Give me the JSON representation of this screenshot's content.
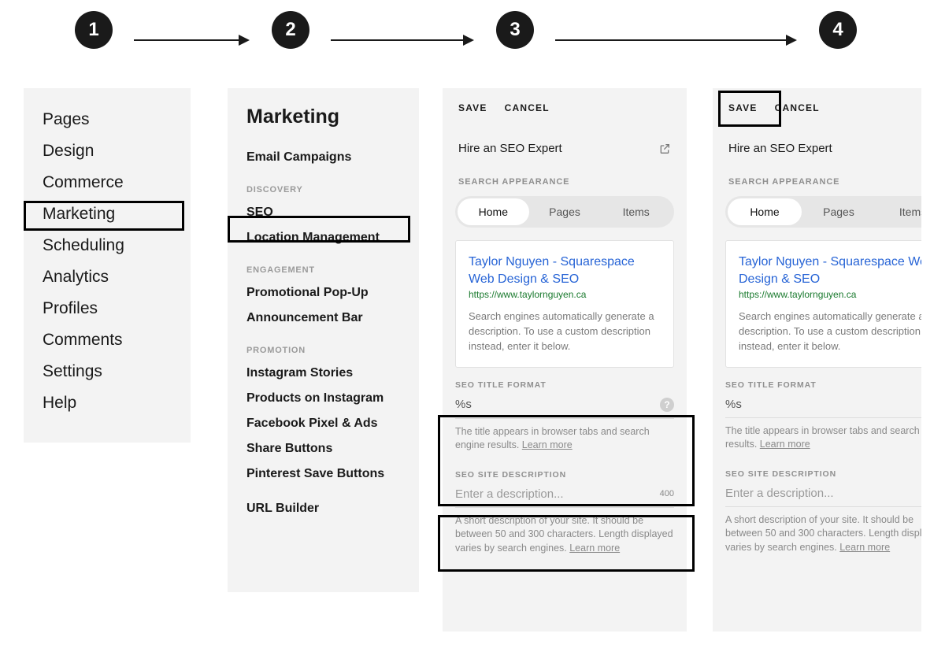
{
  "steps": [
    "1",
    "2",
    "3",
    "4"
  ],
  "panel1": {
    "items": [
      "Pages",
      "Design",
      "Commerce",
      "Marketing",
      "Scheduling",
      "Analytics",
      "Profiles",
      "Comments",
      "Settings",
      "Help"
    ]
  },
  "panel2": {
    "title": "Marketing",
    "groups": [
      {
        "label": null,
        "items": [
          "Email Campaigns"
        ]
      },
      {
        "label": "DISCOVERY",
        "items": [
          "SEO",
          "Location Management"
        ]
      },
      {
        "label": "ENGAGEMENT",
        "items": [
          "Promotional Pop-Up",
          "Announcement Bar"
        ]
      },
      {
        "label": "PROMOTION",
        "items": [
          "Instagram Stories",
          "Products on Instagram",
          "Facebook Pixel & Ads",
          "Share Buttons",
          "Pinterest Save Buttons"
        ]
      },
      {
        "label": null,
        "items": [
          "URL Builder"
        ]
      }
    ]
  },
  "seo": {
    "save": "SAVE",
    "cancel": "CANCEL",
    "hire": "Hire an SEO Expert",
    "search_appearance": "SEARCH APPEARANCE",
    "tabs": [
      "Home",
      "Pages",
      "Items"
    ],
    "preview": {
      "title": "Taylor Nguyen - Squarespace Web Design & SEO",
      "url": "https://www.taylornguyen.ca",
      "desc": "Search engines automatically generate a description. To use a custom description instead, enter it below."
    },
    "title_format": {
      "label": "SEO TITLE FORMAT",
      "value": "%s",
      "note": "The title appears in browser tabs and search engine results. ",
      "learn_more": "Learn more"
    },
    "site_desc": {
      "label": "SEO SITE DESCRIPTION",
      "placeholder": "Enter a description...",
      "counter": "400",
      "note": "A short description of your site. It should be between 50 and 300 characters. Length displayed varies by search engines. ",
      "learn_more": "Learn more"
    }
  }
}
